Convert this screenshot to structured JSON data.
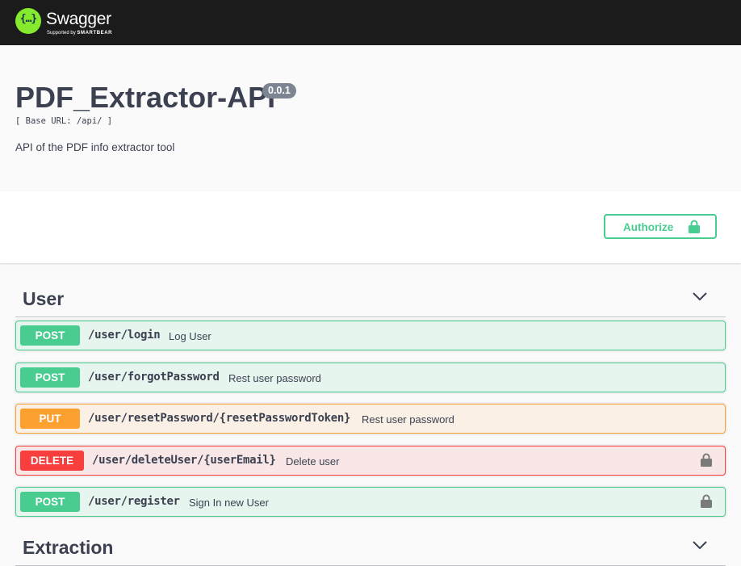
{
  "topbar": {
    "logo_text": "Swagger",
    "logo_sub_prefix": "Supported by",
    "logo_sub_brand": "SMARTBEAR",
    "logo_mark": "{…}",
    "logo_color": "#85ea2d"
  },
  "info": {
    "title": "PDF_Extractor-API",
    "version": "0.0.1",
    "base_url": "[ Base URL: /api/ ]",
    "description": "API of the PDF info extractor tool"
  },
  "authorize": {
    "label": "Authorize",
    "icon": "lock-icon",
    "color": "#49cc90"
  },
  "tags": [
    {
      "name": "User",
      "operations": [
        {
          "method": "POST",
          "path": "/user/login",
          "summary": "Log User",
          "locked": false
        },
        {
          "method": "POST",
          "path": "/user/forgotPassword",
          "summary": "Rest user password",
          "locked": false
        },
        {
          "method": "PUT",
          "path": "/user/resetPassword/{resetPasswordToken}",
          "summary": "Rest user password",
          "locked": false
        },
        {
          "method": "DELETE",
          "path": "/user/deleteUser/{userEmail}",
          "summary": "Delete user",
          "locked": true
        },
        {
          "method": "POST",
          "path": "/user/register",
          "summary": "Sign In new User",
          "locked": true
        }
      ]
    },
    {
      "name": "Extraction",
      "operations": []
    }
  ],
  "method_colors": {
    "POST": "#49cc90",
    "PUT": "#fca130",
    "DELETE": "#f93e3e"
  }
}
